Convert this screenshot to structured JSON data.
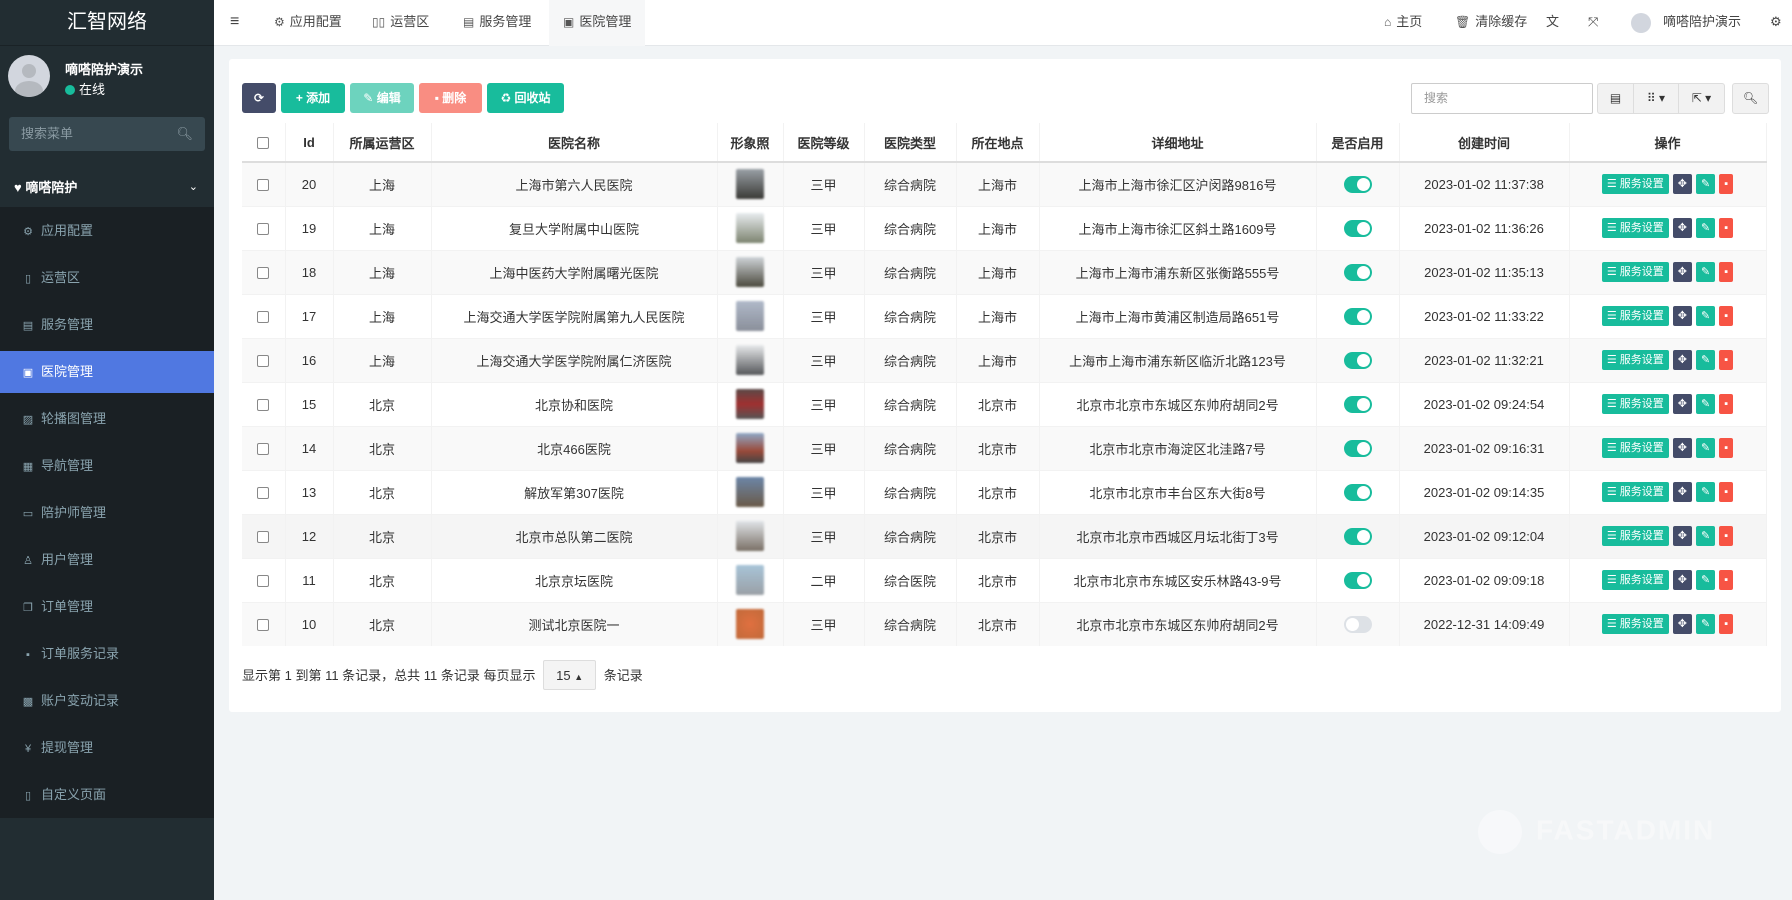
{
  "app": {
    "logo": "汇智网络"
  },
  "user": {
    "name": "嘀嗒陪护演示",
    "status": "在线"
  },
  "sidebar": {
    "search_placeholder": "搜索菜单",
    "group": "嘀嗒陪护",
    "items": [
      {
        "label": "应用配置",
        "icon": "gear-icon"
      },
      {
        "label": "运营区",
        "icon": "map-icon"
      },
      {
        "label": "服务管理",
        "icon": "list-alt-icon"
      },
      {
        "label": "医院管理",
        "icon": "hospital-icon",
        "active": true
      },
      {
        "label": "轮播图管理",
        "icon": "image-icon"
      },
      {
        "label": "导航管理",
        "icon": "table-icon"
      },
      {
        "label": "陪护师管理",
        "icon": "id-card-icon"
      },
      {
        "label": "用户管理",
        "icon": "user-icon"
      },
      {
        "label": "订单管理",
        "icon": "clone-icon"
      },
      {
        "label": "订单服务记录",
        "icon": "floppy-icon"
      },
      {
        "label": "账户变动记录",
        "icon": "calendar-icon"
      },
      {
        "label": "提现管理",
        "icon": "yen-icon"
      },
      {
        "label": "自定义页面",
        "icon": "file-icon"
      }
    ]
  },
  "topbar": {
    "tabs": [
      "应用配置",
      "运营区",
      "服务管理",
      "医院管理"
    ],
    "home": "主页",
    "clear_cache": "清除缓存",
    "username": "嘀嗒陪护演示"
  },
  "toolbar": {
    "add": "添加",
    "edit": "编辑",
    "delete": "删除",
    "recycle": "回收站",
    "search_placeholder": "搜索"
  },
  "table": {
    "headers": [
      "Id",
      "所属运营区",
      "医院名称",
      "形象照",
      "医院等级",
      "医院类型",
      "所在地点",
      "详细地址",
      "是否启用",
      "创建时间",
      "操作"
    ],
    "action_label": "服务设置",
    "rows": [
      {
        "id": "20",
        "region": "上海",
        "name": "上海市第六人民医院",
        "level": "三甲",
        "type": "综合病院",
        "city": "上海市",
        "address": "上海市上海市徐汇区沪闵路9816号",
        "enabled": true,
        "created": "2023-01-02 11:37:38"
      },
      {
        "id": "19",
        "region": "上海",
        "name": "复旦大学附属中山医院",
        "level": "三甲",
        "type": "综合病院",
        "city": "上海市",
        "address": "上海市上海市徐汇区斜土路1609号",
        "enabled": true,
        "created": "2023-01-02 11:36:26"
      },
      {
        "id": "18",
        "region": "上海",
        "name": "上海中医药大学附属曙光医院",
        "level": "三甲",
        "type": "综合病院",
        "city": "上海市",
        "address": "上海市上海市浦东新区张衡路555号",
        "enabled": true,
        "created": "2023-01-02 11:35:13"
      },
      {
        "id": "17",
        "region": "上海",
        "name": "上海交通大学医学院附属第九人民医院",
        "level": "三甲",
        "type": "综合病院",
        "city": "上海市",
        "address": "上海市上海市黄浦区制造局路651号",
        "enabled": true,
        "created": "2023-01-02 11:33:22"
      },
      {
        "id": "16",
        "region": "上海",
        "name": "上海交通大学医学院附属仁济医院",
        "level": "三甲",
        "type": "综合病院",
        "city": "上海市",
        "address": "上海市上海市浦东新区临沂北路123号",
        "enabled": true,
        "created": "2023-01-02 11:32:21"
      },
      {
        "id": "15",
        "region": "北京",
        "name": "北京协和医院",
        "level": "三甲",
        "type": "综合病院",
        "city": "北京市",
        "address": "北京市北京市东城区东帅府胡同2号",
        "enabled": true,
        "created": "2023-01-02 09:24:54"
      },
      {
        "id": "14",
        "region": "北京",
        "name": "北京466医院",
        "level": "三甲",
        "type": "综合病院",
        "city": "北京市",
        "address": "北京市北京市海淀区北洼路7号",
        "enabled": true,
        "created": "2023-01-02 09:16:31"
      },
      {
        "id": "13",
        "region": "北京",
        "name": "解放军第307医院",
        "level": "三甲",
        "type": "综合病院",
        "city": "北京市",
        "address": "北京市北京市丰台区东大街8号",
        "enabled": true,
        "created": "2023-01-02 09:14:35"
      },
      {
        "id": "12",
        "region": "北京",
        "name": "北京市总队第二医院",
        "level": "三甲",
        "type": "综合病院",
        "city": "北京市",
        "address": "北京市北京市西城区月坛北街丁3号",
        "enabled": true,
        "created": "2023-01-02 09:12:04"
      },
      {
        "id": "11",
        "region": "北京",
        "name": "北京京坛医院",
        "level": "二甲",
        "type": "综合医院",
        "city": "北京市",
        "address": "北京市北京市东城区安乐林路43-9号",
        "enabled": true,
        "created": "2023-01-02 09:09:18"
      },
      {
        "id": "10",
        "region": "北京",
        "name": "测试北京医院一",
        "level": "三甲",
        "type": "综合病院",
        "city": "北京市",
        "address": "北京市北京市东城区东帅府胡同2号",
        "enabled": false,
        "created": "2022-12-31 14:09:49"
      }
    ]
  },
  "pagination": {
    "summary": "显示第 1 到第 11 条记录，总共 11 条记录 每页显示",
    "page_size": "15",
    "suffix": "条记录"
  },
  "watermark": "FASTADMIN",
  "colors": {
    "primary": "#18bc9c",
    "navy": "#444c69",
    "danger": "#f75444",
    "active_menu": "#5078e1"
  }
}
